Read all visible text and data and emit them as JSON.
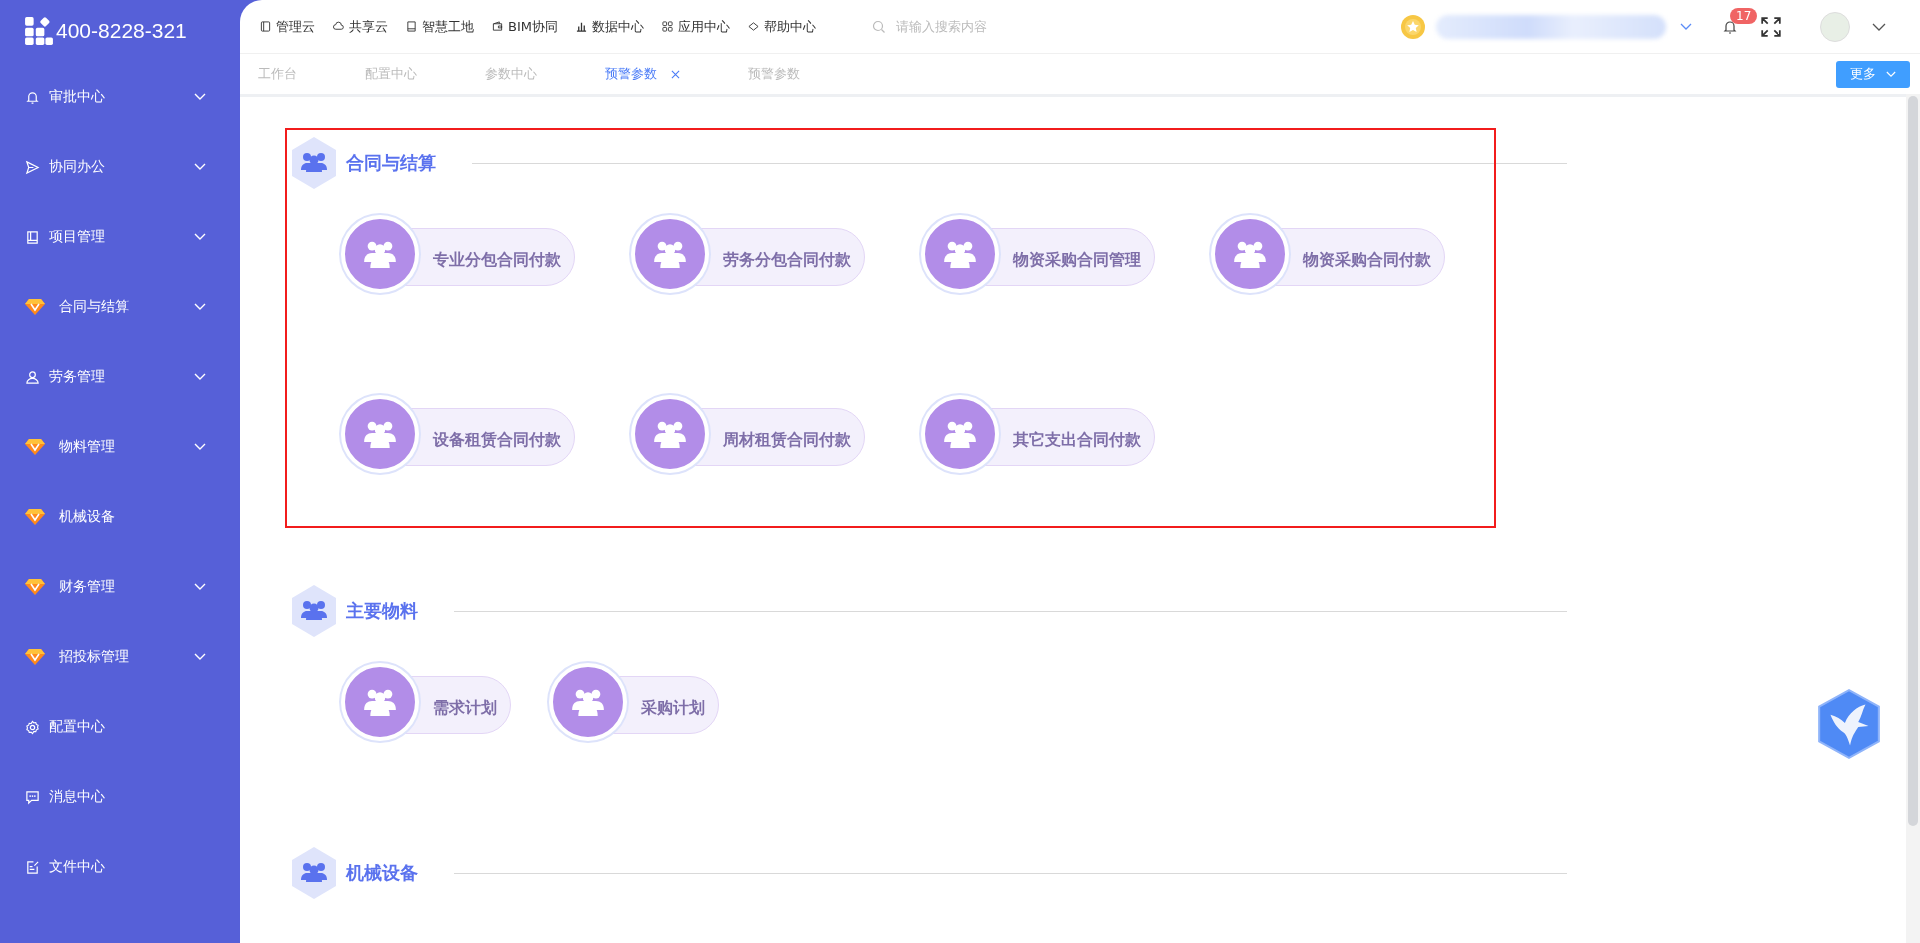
{
  "logo": {
    "phone": "400-8228-321"
  },
  "sidebar": {
    "items": [
      {
        "kind": "bell",
        "label": "审批中心",
        "expandable": true
      },
      {
        "kind": "send",
        "label": "协同办公",
        "expandable": true
      },
      {
        "kind": "book",
        "label": "项目管理",
        "expandable": true
      },
      {
        "kind": "gem",
        "label": "合同与结算",
        "expandable": true
      },
      {
        "kind": "user",
        "label": "劳务管理",
        "expandable": true
      },
      {
        "kind": "gem",
        "label": "物料管理",
        "expandable": true
      },
      {
        "kind": "gem",
        "label": "机械设备",
        "expandable": false
      },
      {
        "kind": "gem",
        "label": "财务管理",
        "expandable": true
      },
      {
        "kind": "gem",
        "label": "招投标管理",
        "expandable": true
      },
      {
        "kind": "gear",
        "label": "配置中心",
        "expandable": false
      },
      {
        "kind": "chat",
        "label": "消息中心",
        "expandable": false
      },
      {
        "kind": "edit",
        "label": "文件中心",
        "expandable": false
      }
    ]
  },
  "top_nav": [
    {
      "kind": "panel",
      "label": "管理云"
    },
    {
      "kind": "cloud",
      "label": "共享云"
    },
    {
      "kind": "book",
      "label": "智慧工地"
    },
    {
      "kind": "wallet",
      "label": "BIM协同"
    },
    {
      "kind": "bars",
      "label": "数据中心"
    },
    {
      "kind": "grid",
      "label": "应用中心"
    },
    {
      "kind": "diamond",
      "label": "帮助中心"
    }
  ],
  "search": {
    "placeholder": "请输入搜索内容"
  },
  "notifications": {
    "badge": "17"
  },
  "tabs": [
    {
      "label": "工作台",
      "selected": false
    },
    {
      "label": "配置中心",
      "selected": false
    },
    {
      "label": "参数中心",
      "selected": false
    },
    {
      "label": "预警参数",
      "selected": true
    },
    {
      "label": "预警参数",
      "selected": false
    }
  ],
  "more_button": {
    "label": "更多"
  },
  "sections": [
    {
      "title": "合同与结算",
      "highlighted": true,
      "items": [
        "专业分包合同付款",
        "劳务分包合同付款",
        "物资采购合同管理",
        "物资采购合同付款",
        "设备租赁合同付款",
        "周材租赁合同付款",
        "其它支出合同付款"
      ]
    },
    {
      "title": "主要物料",
      "highlighted": false,
      "items": [
        "需求计划",
        "采购计划"
      ]
    },
    {
      "title": "机械设备",
      "highlighted": false
    }
  ]
}
